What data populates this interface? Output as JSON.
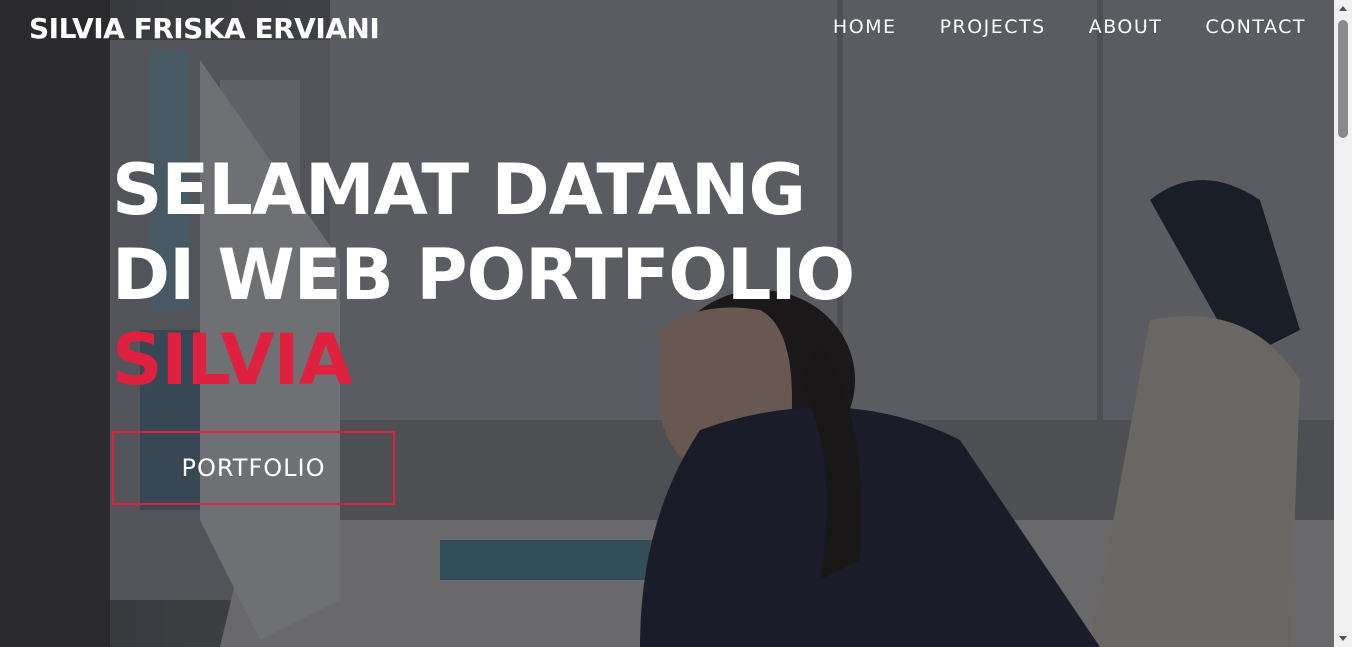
{
  "nav": {
    "brand": "SILVIA FRISKA ERVIANI",
    "links": [
      "HOME",
      "PROJECTS",
      "ABOUT",
      "CONTACT"
    ]
  },
  "hero": {
    "line1": "SELAMAT DATANG",
    "line2": "DI WEB PORTFOLIO",
    "accent": "SILVIA",
    "cta": "PORTFOLIO"
  },
  "colors": {
    "accent": "#e0203f",
    "text": "#ffffff"
  }
}
